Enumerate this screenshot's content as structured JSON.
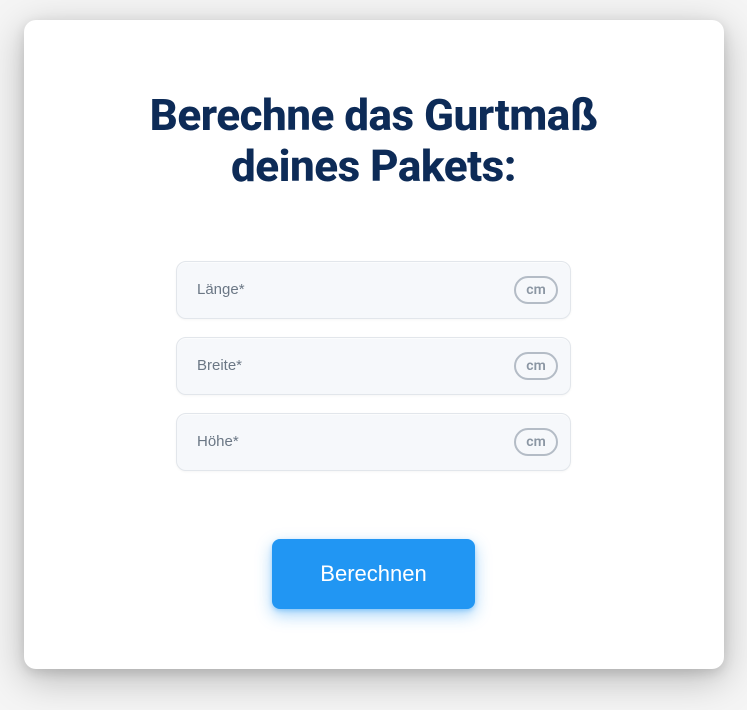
{
  "heading": "Berechne das Gurtmaß deines Pakets:",
  "fields": {
    "length": {
      "placeholder": "Länge*",
      "unit": "cm"
    },
    "width": {
      "placeholder": "Breite*",
      "unit": "cm"
    },
    "height": {
      "placeholder": "Höhe*",
      "unit": "cm"
    }
  },
  "button": {
    "label": "Berechnen"
  },
  "colors": {
    "heading": "#0d2b57",
    "button_bg": "#2196f3",
    "input_bg": "#f6f8fb"
  }
}
